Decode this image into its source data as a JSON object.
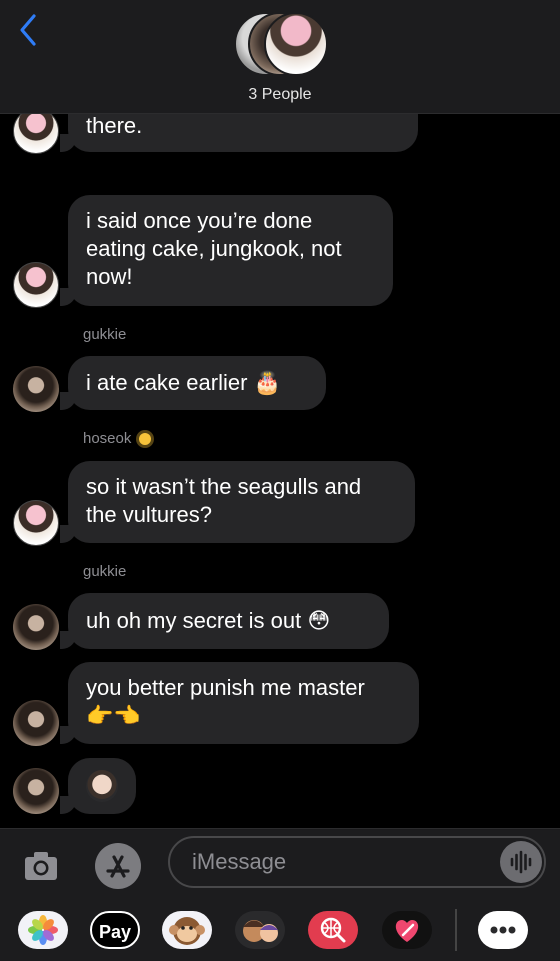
{
  "header": {
    "title": "3 People"
  },
  "messages": [
    {
      "sender": "",
      "text": "there."
    },
    {
      "sender": "",
      "text": "i said once you’re done eating cake, jungkook, not now!"
    },
    {
      "sender": "gukkie",
      "text": "i ate cake earlier",
      "emoji": "🎂"
    },
    {
      "sender": "hoseok",
      "text": "so it wasn’t the seagulls and the vultures?"
    },
    {
      "sender": "gukkie",
      "text": "uh oh my secret is out",
      "emoji": "😳"
    },
    {
      "sender": "",
      "text": "you better punish me master",
      "emoji": "👉👈"
    },
    {
      "sender": "",
      "text": "",
      "emoji": "memoji-sticker"
    }
  ],
  "compose": {
    "placeholder": "iMessage"
  },
  "drawer": {
    "apps": [
      {
        "name": "photos-app",
        "label": ""
      },
      {
        "name": "apple-pay-app",
        "label": "Pay"
      },
      {
        "name": "animoji-app",
        "label": ""
      },
      {
        "name": "memoji-stickers-app",
        "label": ""
      },
      {
        "name": "images-search-app",
        "label": ""
      },
      {
        "name": "digital-touch-app",
        "label": ""
      },
      {
        "name": "more-apps",
        "label": ""
      }
    ]
  },
  "colors": {
    "accent": "#2f7cf6",
    "bubble": "#262628",
    "background": "#000000",
    "bar": "#1c1c1e"
  }
}
